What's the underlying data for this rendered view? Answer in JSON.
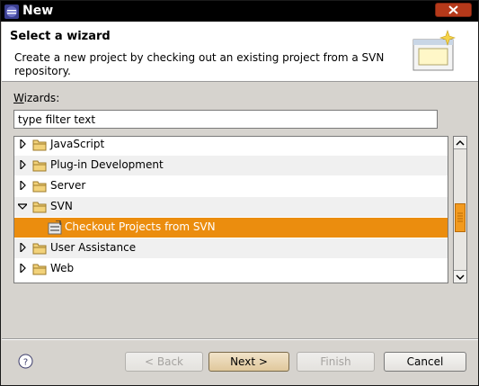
{
  "window": {
    "title": "New"
  },
  "header": {
    "heading": "Select a wizard",
    "description": "Create a new project by checking out an existing project from a SVN repository."
  },
  "wizards": {
    "label": "Wizards:",
    "mnemonic": "W",
    "label_rest": "izards:",
    "filter_value": "type filter text"
  },
  "tree": {
    "items": [
      {
        "label": "JavaScript",
        "expanded": false,
        "selected": false
      },
      {
        "label": "Plug-in Development",
        "expanded": false,
        "selected": false
      },
      {
        "label": "Server",
        "expanded": false,
        "selected": false
      },
      {
        "label": "SVN",
        "expanded": true,
        "selected": false
      },
      {
        "label": "Checkout Projects from SVN",
        "expanded": null,
        "selected": true
      },
      {
        "label": "User Assistance",
        "expanded": false,
        "selected": false
      },
      {
        "label": "Web",
        "expanded": false,
        "selected": false
      }
    ]
  },
  "buttons": {
    "back": "< Back",
    "back_mnemonic": "B",
    "next": "Next >",
    "next_mnemonic": "N",
    "finish": "Finish",
    "finish_mnemonic": "F",
    "cancel": "Cancel"
  },
  "colors": {
    "selection": "#eb8d0e",
    "scroll_thumb": "#f29a1f",
    "titlebar": "#000000",
    "dialog_bg": "#d6d3ce"
  },
  "icons": {
    "app": "eclipse-icon",
    "close": "close-icon",
    "wizard_banner": "new-wizard-banner-icon",
    "folder": "folder-icon",
    "svn_checkout": "svn-checkout-icon",
    "help": "help-icon"
  }
}
